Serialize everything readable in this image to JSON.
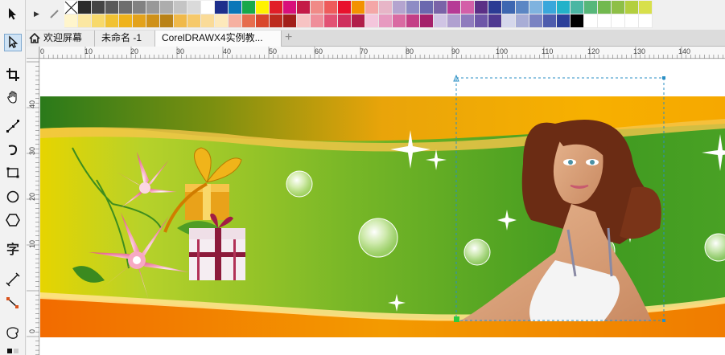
{
  "tabs": {
    "welcome": "欢迎屏幕",
    "untitled": "未命名 -1",
    "document": "CorelDRAWX4实例教..."
  },
  "ruler": {
    "h_labels": [
      "0",
      "10",
      "20",
      "30",
      "40",
      "50",
      "60",
      "70",
      "80",
      "90",
      "100",
      "110",
      "120",
      "130",
      "140"
    ],
    "v_labels": [
      "40",
      "30",
      "20",
      "10",
      "0"
    ]
  },
  "palette": {
    "row1": [
      "#000000",
      "#2b2b2b",
      "#454545",
      "#5a5a5a",
      "#6e6e6e",
      "#828282",
      "#999999",
      "#adadad",
      "#c4c4c4",
      "#dadada",
      "#ffffff",
      "#1d2f8c",
      "#0a76b8",
      "#18a84b",
      "#fff200",
      "#e11e28",
      "#d80f7b",
      "#c41a47",
      "#f08a87",
      "#ee5b5b",
      "#e8112d",
      "#f39200",
      "#f4a7a7",
      "#e7b5c7",
      "#b4a4cf",
      "#8e8cc4",
      "#6b68ae",
      "#7a63a8",
      "#b63b96",
      "#d35fa8",
      "#5b2f86",
      "#2b3b94",
      "#3e67b1",
      "#5b86c4",
      "#7fb3df",
      "#3aa7db",
      "#23b2c9",
      "#4ab6a3",
      "#57b77a",
      "#72b94f",
      "#8ebf47",
      "#b3cf3f",
      "#d8e04b"
    ],
    "row2": [
      "#fff5cc",
      "#fbe7a1",
      "#f7d96b",
      "#f1c232",
      "#efb31b",
      "#e3a21a",
      "#cf9118",
      "#b98217",
      "#f0b94a",
      "#f6c96b",
      "#fadb98",
      "#fde9bb",
      "#f6b0a0",
      "#e66d4e",
      "#d9472b",
      "#bd2b1e",
      "#a21f1a",
      "#f7c3c3",
      "#ef8e9a",
      "#e25274",
      "#cf2f5d",
      "#b11e4a",
      "#f4c6dc",
      "#e79ac0",
      "#d96aa2",
      "#c43f86",
      "#a5216b",
      "#d0c4e4",
      "#b0a0d0",
      "#8f7bbd",
      "#6e57a8",
      "#4f3991",
      "#d5d7eb",
      "#a8add6",
      "#7a83c2",
      "#4e5cad",
      "#2c3f99",
      "#000000",
      "#ffffff",
      "#ffffff",
      "#ffffff",
      "#ffffff",
      "#ffffff"
    ]
  },
  "colors": {
    "accent": "#2a7fc6",
    "selection": "#2a8fc4"
  },
  "icons": [
    "pick-tool-icon",
    "shape-tool-icon",
    "crop-tool-icon",
    "pan-tool-icon",
    "freehand-tool-icon",
    "smart-drawing-tool-icon",
    "rectangle-tool-icon",
    "ellipse-tool-icon",
    "polygon-tool-icon",
    "text-tool-icon",
    "parallel-dimension-icon",
    "connector-tool-icon",
    "interactive-blend-icon",
    "transparency-icon"
  ]
}
